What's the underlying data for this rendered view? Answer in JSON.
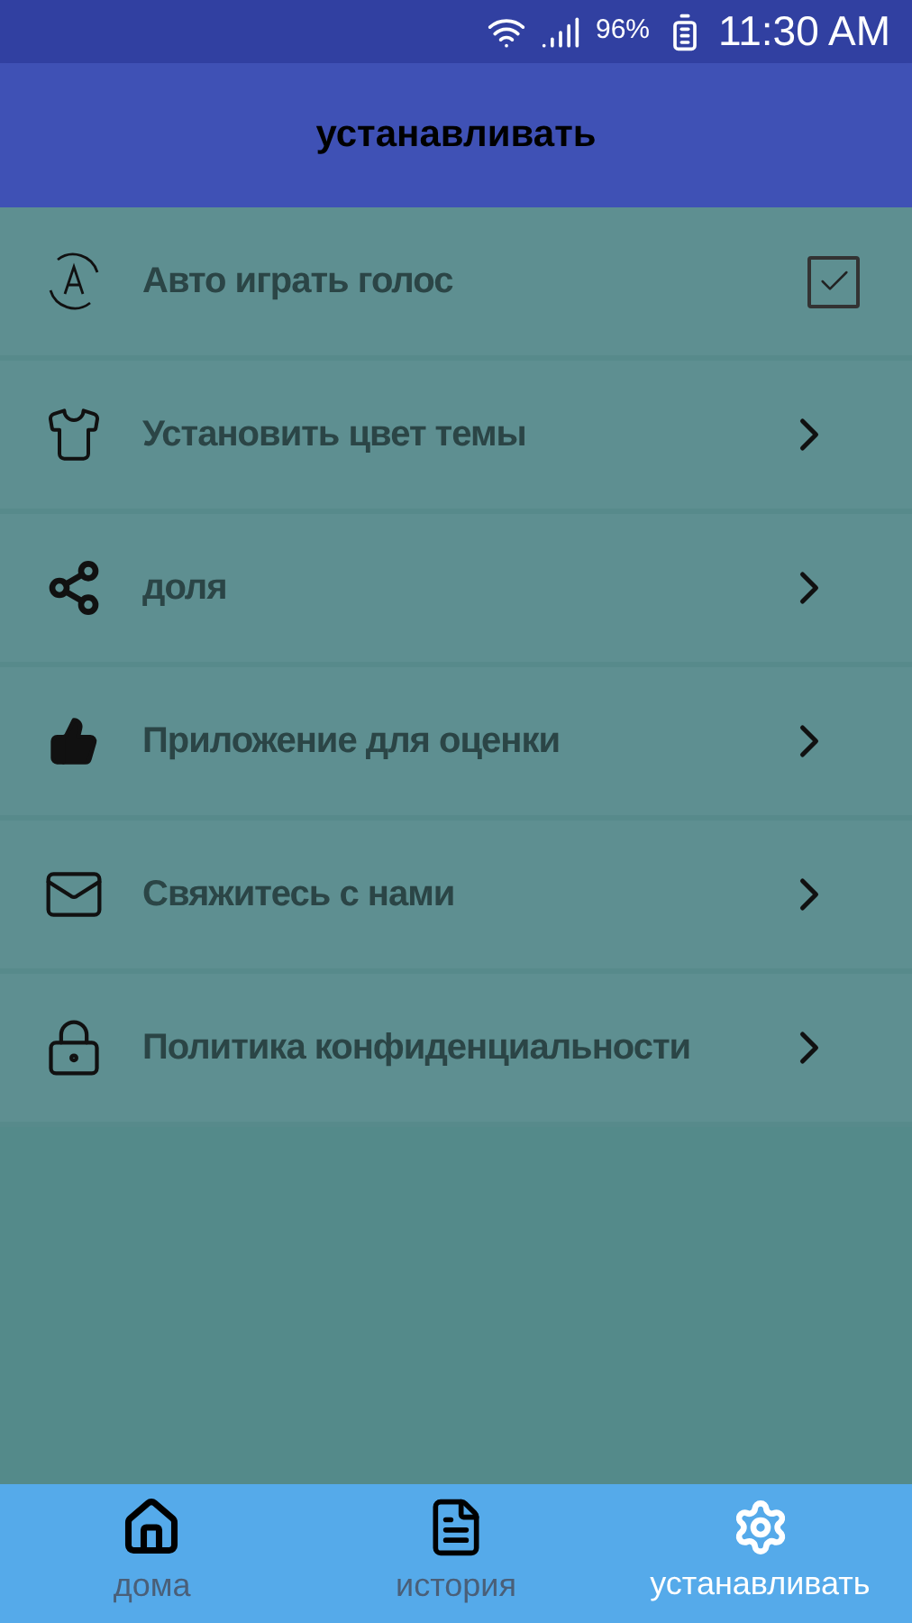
{
  "status_bar": {
    "battery": "96%",
    "time": "11:30 AM"
  },
  "app_bar": {
    "title": "устанавливать"
  },
  "settings": [
    {
      "label": "Авто играть голос",
      "kind": "checkbox",
      "checked": true
    },
    {
      "label": "Установить цвет темы",
      "kind": "link"
    },
    {
      "label": "доля",
      "kind": "link"
    },
    {
      "label": "Приложение для оценки",
      "kind": "link"
    },
    {
      "label": "Свяжитесь с нами",
      "kind": "link"
    },
    {
      "label": "Политика конфиденциальности",
      "kind": "link"
    }
  ],
  "bottom_nav": [
    {
      "label": "дома",
      "selected": false
    },
    {
      "label": "история",
      "selected": false
    },
    {
      "label": "устанавливать",
      "selected": true
    }
  ]
}
